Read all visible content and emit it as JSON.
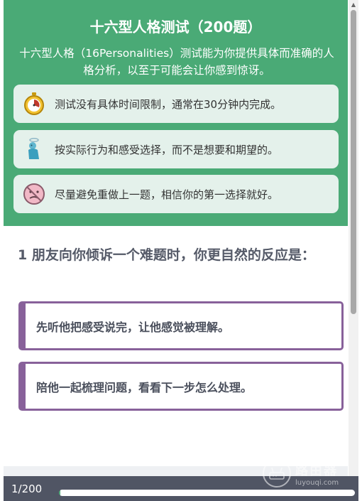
{
  "header": {
    "title": "十六型人格测试（200题）",
    "description": "十六型人格（16Personalities）测试能为你提供具体而准确的人格分析，以至于可能会让你感到惊讶。"
  },
  "tips": [
    {
      "icon": "stopwatch-icon",
      "text": "测试没有具体时间限制，通常在30分钟内完成。"
    },
    {
      "icon": "angel-figure-icon",
      "text": "按实际行为和感受选择，而不是想要和期望的。"
    },
    {
      "icon": "no-face-icon",
      "text": "尽量避免重做上一题，相信你的第一选择就好。"
    }
  ],
  "question": {
    "number": "1",
    "text": "朋友向你倾诉一个难题时，你更自然的反应是：",
    "options": [
      {
        "label": "先听他把感受说完，让他感觉被理解。"
      },
      {
        "label": "陪他一起梳理问题，看看下一步怎么处理。"
      }
    ]
  },
  "progress": {
    "label": "1/200",
    "fraction": 0.005
  },
  "watermark": {
    "name": "路由器",
    "url": "luyouqi.com"
  },
  "colors": {
    "header_green": "#4aaa76",
    "tip_bg": "#e4f1eb",
    "option_border": "#88619a",
    "progress_bg": "#505564"
  }
}
